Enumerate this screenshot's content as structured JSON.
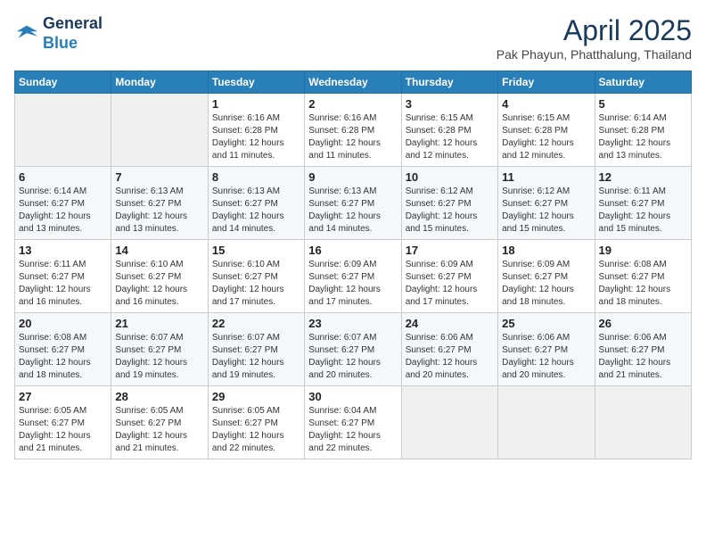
{
  "header": {
    "logo_line1": "General",
    "logo_line2": "Blue",
    "title": "April 2025",
    "subtitle": "Pak Phayun, Phatthalung, Thailand"
  },
  "weekdays": [
    "Sunday",
    "Monday",
    "Tuesday",
    "Wednesday",
    "Thursday",
    "Friday",
    "Saturday"
  ],
  "weeks": [
    [
      {
        "day": "",
        "empty": true
      },
      {
        "day": "",
        "empty": true
      },
      {
        "day": "1",
        "sunrise": "6:16 AM",
        "sunset": "6:28 PM",
        "daylight": "12 hours and 11 minutes."
      },
      {
        "day": "2",
        "sunrise": "6:16 AM",
        "sunset": "6:28 PM",
        "daylight": "12 hours and 11 minutes."
      },
      {
        "day": "3",
        "sunrise": "6:15 AM",
        "sunset": "6:28 PM",
        "daylight": "12 hours and 12 minutes."
      },
      {
        "day": "4",
        "sunrise": "6:15 AM",
        "sunset": "6:28 PM",
        "daylight": "12 hours and 12 minutes."
      },
      {
        "day": "5",
        "sunrise": "6:14 AM",
        "sunset": "6:28 PM",
        "daylight": "12 hours and 13 minutes."
      }
    ],
    [
      {
        "day": "6",
        "sunrise": "6:14 AM",
        "sunset": "6:27 PM",
        "daylight": "12 hours and 13 minutes."
      },
      {
        "day": "7",
        "sunrise": "6:13 AM",
        "sunset": "6:27 PM",
        "daylight": "12 hours and 13 minutes."
      },
      {
        "day": "8",
        "sunrise": "6:13 AM",
        "sunset": "6:27 PM",
        "daylight": "12 hours and 14 minutes."
      },
      {
        "day": "9",
        "sunrise": "6:13 AM",
        "sunset": "6:27 PM",
        "daylight": "12 hours and 14 minutes."
      },
      {
        "day": "10",
        "sunrise": "6:12 AM",
        "sunset": "6:27 PM",
        "daylight": "12 hours and 15 minutes."
      },
      {
        "day": "11",
        "sunrise": "6:12 AM",
        "sunset": "6:27 PM",
        "daylight": "12 hours and 15 minutes."
      },
      {
        "day": "12",
        "sunrise": "6:11 AM",
        "sunset": "6:27 PM",
        "daylight": "12 hours and 15 minutes."
      }
    ],
    [
      {
        "day": "13",
        "sunrise": "6:11 AM",
        "sunset": "6:27 PM",
        "daylight": "12 hours and 16 minutes."
      },
      {
        "day": "14",
        "sunrise": "6:10 AM",
        "sunset": "6:27 PM",
        "daylight": "12 hours and 16 minutes."
      },
      {
        "day": "15",
        "sunrise": "6:10 AM",
        "sunset": "6:27 PM",
        "daylight": "12 hours and 17 minutes."
      },
      {
        "day": "16",
        "sunrise": "6:09 AM",
        "sunset": "6:27 PM",
        "daylight": "12 hours and 17 minutes."
      },
      {
        "day": "17",
        "sunrise": "6:09 AM",
        "sunset": "6:27 PM",
        "daylight": "12 hours and 17 minutes."
      },
      {
        "day": "18",
        "sunrise": "6:09 AM",
        "sunset": "6:27 PM",
        "daylight": "12 hours and 18 minutes."
      },
      {
        "day": "19",
        "sunrise": "6:08 AM",
        "sunset": "6:27 PM",
        "daylight": "12 hours and 18 minutes."
      }
    ],
    [
      {
        "day": "20",
        "sunrise": "6:08 AM",
        "sunset": "6:27 PM",
        "daylight": "12 hours and 18 minutes."
      },
      {
        "day": "21",
        "sunrise": "6:07 AM",
        "sunset": "6:27 PM",
        "daylight": "12 hours and 19 minutes."
      },
      {
        "day": "22",
        "sunrise": "6:07 AM",
        "sunset": "6:27 PM",
        "daylight": "12 hours and 19 minutes."
      },
      {
        "day": "23",
        "sunrise": "6:07 AM",
        "sunset": "6:27 PM",
        "daylight": "12 hours and 20 minutes."
      },
      {
        "day": "24",
        "sunrise": "6:06 AM",
        "sunset": "6:27 PM",
        "daylight": "12 hours and 20 minutes."
      },
      {
        "day": "25",
        "sunrise": "6:06 AM",
        "sunset": "6:27 PM",
        "daylight": "12 hours and 20 minutes."
      },
      {
        "day": "26",
        "sunrise": "6:06 AM",
        "sunset": "6:27 PM",
        "daylight": "12 hours and 21 minutes."
      }
    ],
    [
      {
        "day": "27",
        "sunrise": "6:05 AM",
        "sunset": "6:27 PM",
        "daylight": "12 hours and 21 minutes."
      },
      {
        "day": "28",
        "sunrise": "6:05 AM",
        "sunset": "6:27 PM",
        "daylight": "12 hours and 21 minutes."
      },
      {
        "day": "29",
        "sunrise": "6:05 AM",
        "sunset": "6:27 PM",
        "daylight": "12 hours and 22 minutes."
      },
      {
        "day": "30",
        "sunrise": "6:04 AM",
        "sunset": "6:27 PM",
        "daylight": "12 hours and 22 minutes."
      },
      {
        "day": "",
        "empty": true
      },
      {
        "day": "",
        "empty": true
      },
      {
        "day": "",
        "empty": true
      }
    ]
  ],
  "labels": {
    "sunrise": "Sunrise: ",
    "sunset": "Sunset: ",
    "daylight": "Daylight: "
  }
}
